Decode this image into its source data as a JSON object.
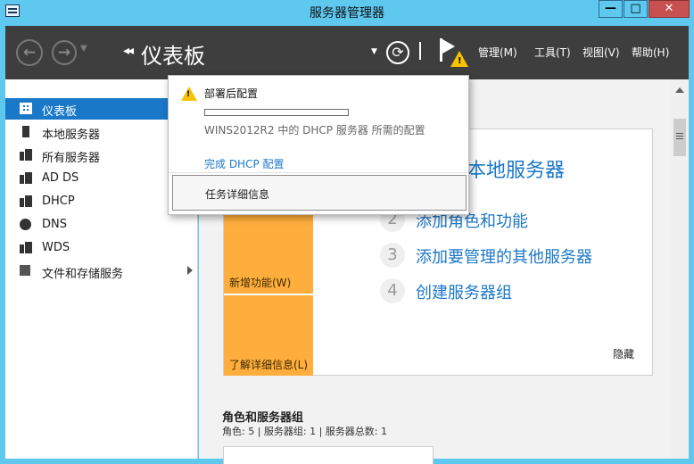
{
  "window": {
    "title": "服务器管理器",
    "minimize": "—",
    "maximize": "□",
    "close": "✕"
  },
  "header": {
    "breadcrumb_arrows": "◂◂",
    "title": "仪表板",
    "menus": {
      "manage": "管理(M)",
      "tools": "工具(T)",
      "view": "视图(V)",
      "help": "帮助(H)"
    }
  },
  "sidebar": {
    "items": [
      {
        "label": "仪表板",
        "icon": "dashboard-icon",
        "active": true
      },
      {
        "label": "本地服务器",
        "icon": "server-icon"
      },
      {
        "label": "所有服务器",
        "icon": "servers-icon"
      },
      {
        "label": "AD DS",
        "icon": "ad-ds-icon"
      },
      {
        "label": "DHCP",
        "icon": "dhcp-icon"
      },
      {
        "label": "DNS",
        "icon": "dns-icon"
      },
      {
        "label": "WDS",
        "icon": "wds-icon"
      },
      {
        "label": "文件和存储服务",
        "icon": "files-icon",
        "expandable": true
      }
    ]
  },
  "welcome": {
    "title": "本地服务器",
    "steps": [
      {
        "num": "2",
        "label": "添加角色和功能"
      },
      {
        "num": "3",
        "label": "添加要管理的其他服务器"
      },
      {
        "num": "4",
        "label": "创建服务器组"
      }
    ],
    "whats_new": "新增功能(W)",
    "learn_more": "了解详细信息(L)",
    "hide": "隐藏"
  },
  "roles": {
    "title": "角色和服务器组",
    "summary": "角色: 5 | 服务器组: 1 | 服务器总数: 1"
  },
  "notification": {
    "title": "部署后配置",
    "progress_fraction": 0.0,
    "description": "WINS2012R2 中的 DHCP 服务器 所需的配置",
    "link": "完成 DHCP 配置",
    "task_details": "任务详细信息"
  },
  "colors": {
    "accent": "#1c78c8",
    "sidebar_active": "#1978c8",
    "header": "#3e3e3e",
    "title_bar": "#5ec8ef",
    "tile_orange": "#ffae3d",
    "warning": "#f7c300"
  }
}
